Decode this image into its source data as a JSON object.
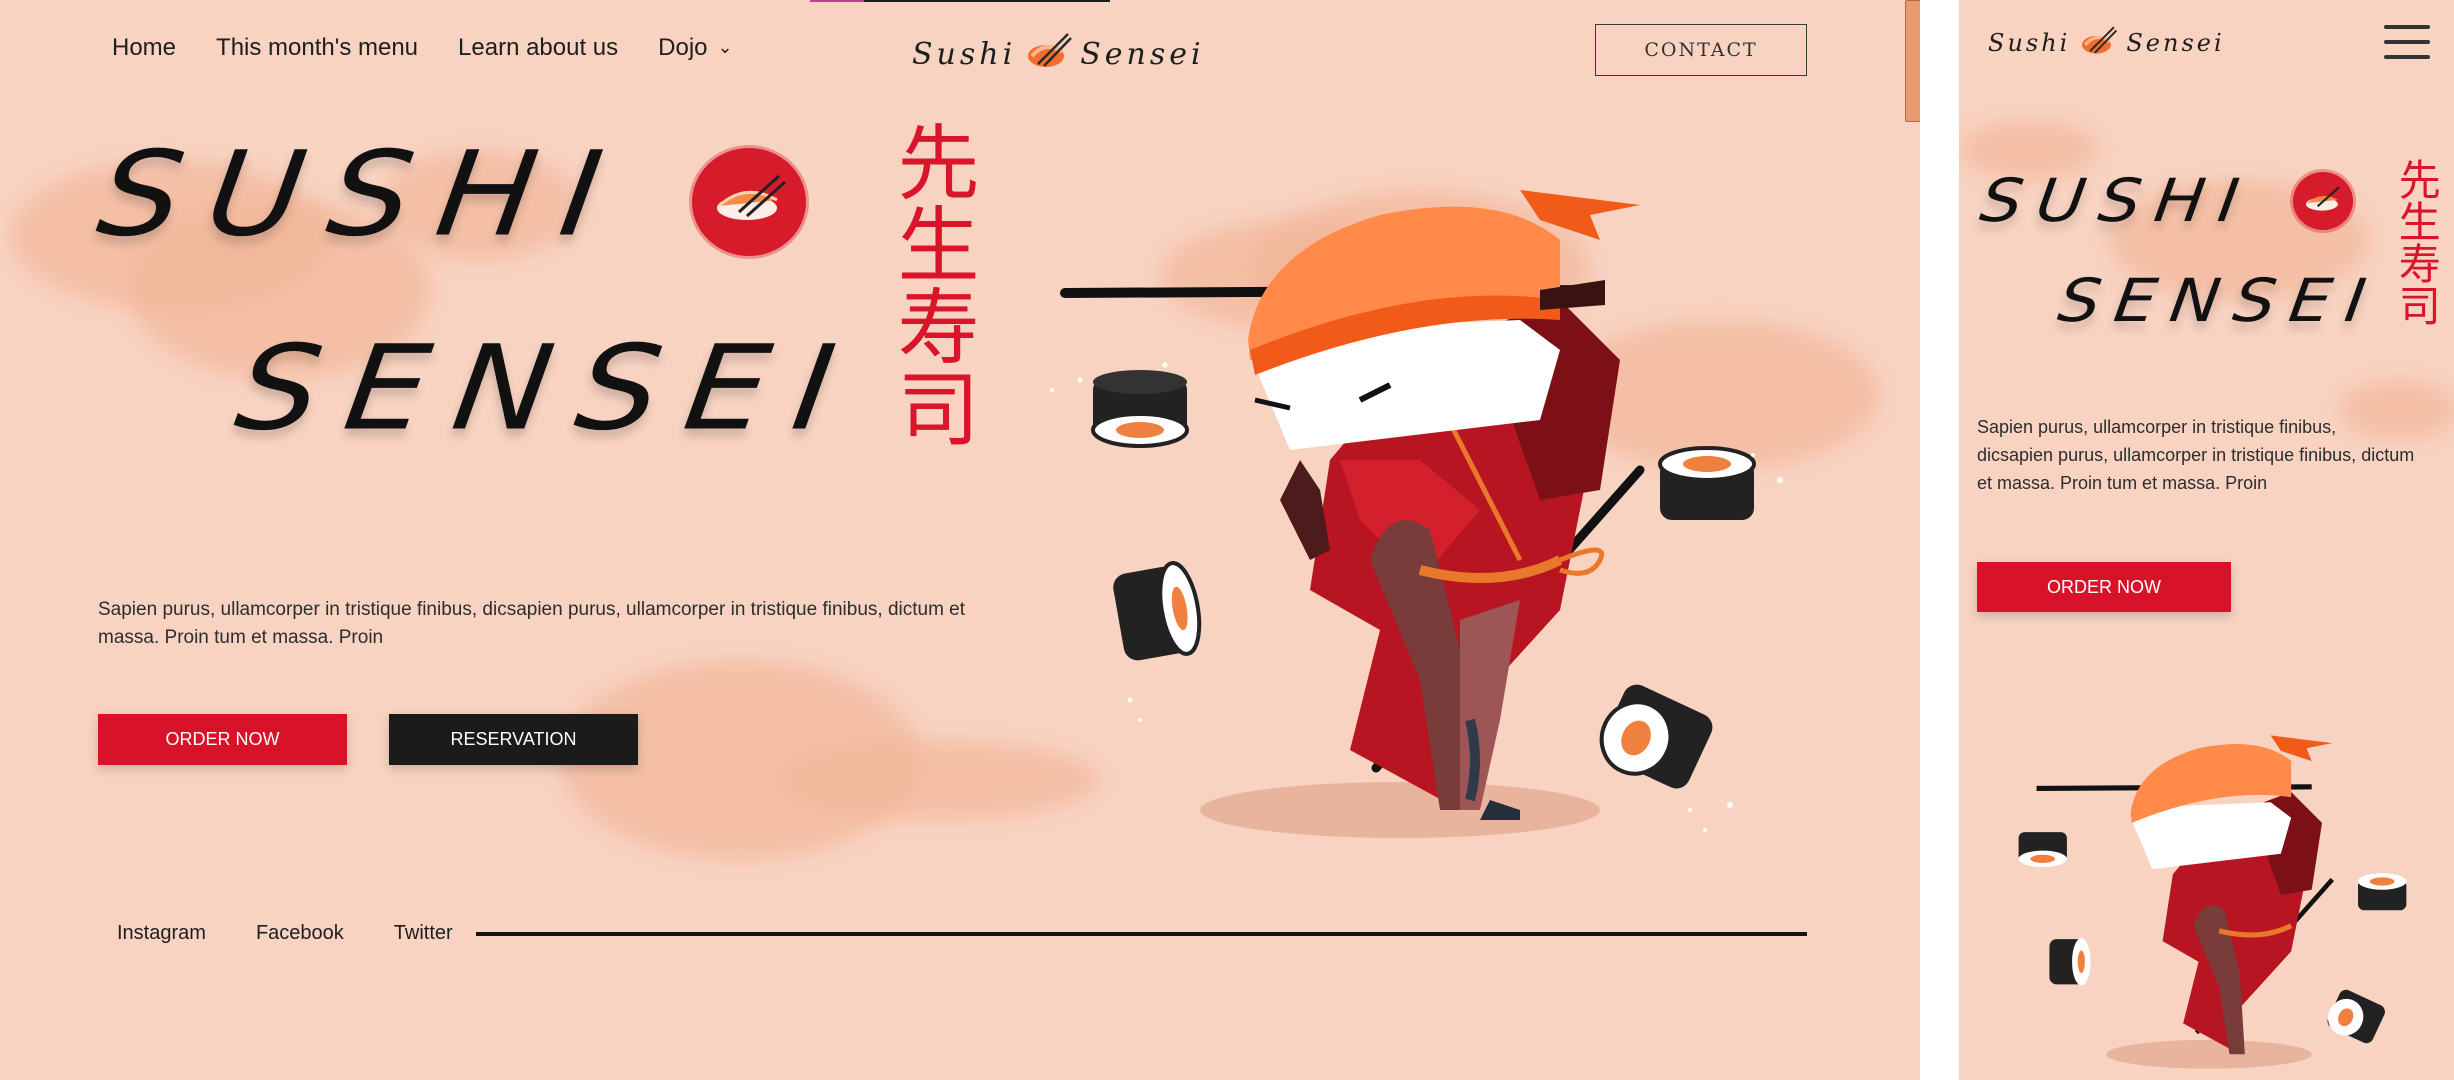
{
  "nav": {
    "items": [
      {
        "label": "Home"
      },
      {
        "label": "This month's menu"
      },
      {
        "label": "Learn about us"
      },
      {
        "label": "Dojo"
      }
    ]
  },
  "logo": {
    "word1": "Sushi",
    "word2": "Sensei"
  },
  "contact_label": "CONTACT",
  "hero": {
    "title_line1": "SUSHI",
    "title_line2": "SENSEI",
    "kanji": "先生寿司",
    "description": "Sapien purus, ullamcorper in tristique finibus, dicsapien purus, ullamcorper in tristique finibus, dictum et massa. Proin tum et massa. Proin",
    "order_label": "ORDER NOW",
    "reservation_label": "RESERVATION"
  },
  "social": [
    {
      "label": "Instagram"
    },
    {
      "label": "Facebook"
    },
    {
      "label": "Twitter"
    }
  ],
  "mobile": {
    "description": "Sapien purus, ullamcorper in tristique finibus, dicsapien purus, ullamcorper in tristique finibus, dictum et massa. Proin tum et massa. Proin",
    "order_label": "ORDER NOW"
  },
  "colors": {
    "background": "#f8d3c2",
    "accent_red": "#d81228",
    "dark_button": "#1b1b1b",
    "cloud": "#f2b597"
  },
  "icons": [
    "chevron-down-icon",
    "sushi-logo-icon",
    "sushi-sun-icon",
    "hamburger-menu-icon",
    "sushi-ninja-illustration"
  ]
}
